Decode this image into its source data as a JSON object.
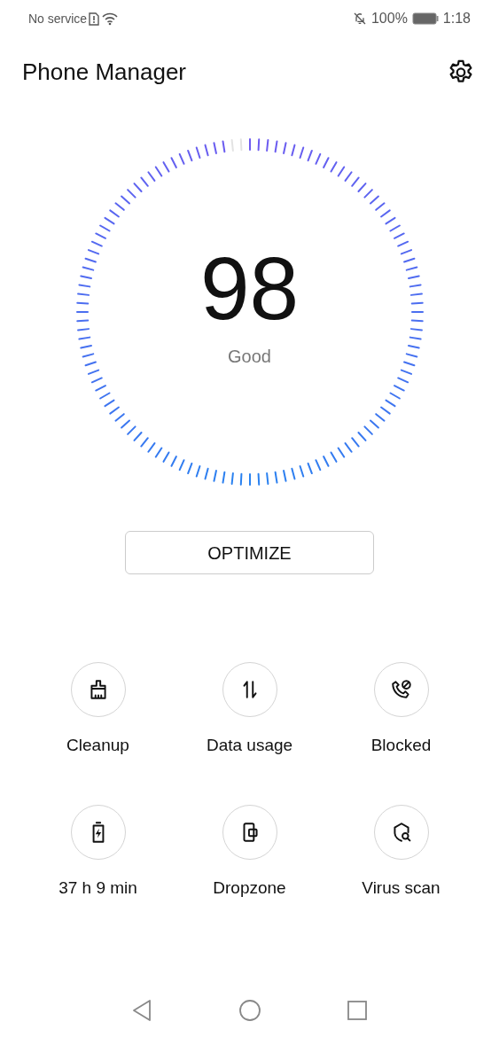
{
  "status_bar": {
    "carrier": "No service",
    "battery": "100%",
    "time": "1:18"
  },
  "title": "Phone Manager",
  "score": {
    "value": "98",
    "label": "Good"
  },
  "optimize_button": "OPTIMIZE",
  "tools": [
    {
      "kind": "cleanup",
      "label": "Cleanup"
    },
    {
      "kind": "data",
      "label": "Data usage"
    },
    {
      "kind": "blocked",
      "label": "Blocked"
    },
    {
      "kind": "battery",
      "label": "37 h 9 min"
    },
    {
      "kind": "dropzone",
      "label": "Dropzone"
    },
    {
      "kind": "virus",
      "label": "Virus scan"
    }
  ]
}
